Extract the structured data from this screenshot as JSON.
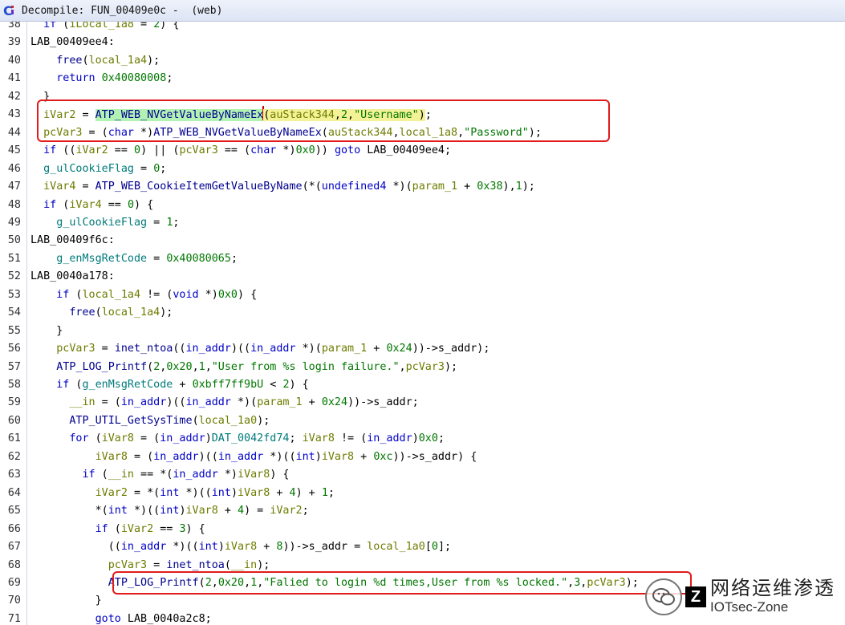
{
  "window": {
    "title": "Decompile: FUN_00409e0c -  (web)",
    "icon": "decompiler-icon"
  },
  "lines": [
    {
      "n": "38",
      "html": "  <span class='kw'>if</span> (<span class='var'>iLocal_1a8</span> = <span class='num'>2</span>) {"
    },
    {
      "n": "39",
      "html": "<span class='lab'>LAB_00409ee4:</span>"
    },
    {
      "n": "40",
      "html": "    <span class='fn'>free</span>(<span class='var'>local_1a4</span>);"
    },
    {
      "n": "41",
      "html": "    <span class='kw'>return</span> <span class='num'>0x40080008</span>;"
    },
    {
      "n": "42",
      "html": "  }"
    },
    {
      "n": "43",
      "html": "  <span class='var'>iVar2</span> = <span class='fn hl-fn'>ATP_WEB_NVGetValueByNameEx</span><span class='cursor'></span><span class='hl-args'>(<span class='var'>auStack344</span>,<span class='num'>2</span>,<span class='str'>\"Username\"</span>)</span>;"
    },
    {
      "n": "44",
      "html": "  <span class='var'>pcVar3</span> = (<span class='typ'>char</span> *)<span class='fn'>ATP_WEB_NVGetValueByNameEx</span>(<span class='var'>auStack344</span>,<span class='var'>local_1a8</span>,<span class='str'>\"Password\"</span>);"
    },
    {
      "n": "45",
      "html": "  <span class='kw'>if</span> ((<span class='var'>iVar2</span> == <span class='num'>0</span>) || (<span class='var'>pcVar3</span> == (<span class='typ'>char</span> *)<span class='num'>0x0</span>)) <span class='kw'>goto</span> LAB_00409ee4;"
    },
    {
      "n": "46",
      "html": "  <span class='glb'>g_ulCookieFlag</span> = <span class='num'>0</span>;"
    },
    {
      "n": "47",
      "html": "  <span class='var'>iVar4</span> = <span class='fn'>ATP_WEB_CookieItemGetValueByName</span>(*(<span class='typ'>undefined4</span> *)(<span class='var'>param_1</span> + <span class='num'>0x38</span>),<span class='num'>1</span>);"
    },
    {
      "n": "48",
      "html": "  <span class='kw'>if</span> (<span class='var'>iVar4</span> == <span class='num'>0</span>) {"
    },
    {
      "n": "49",
      "html": "    <span class='glb'>g_ulCookieFlag</span> = <span class='num'>1</span>;"
    },
    {
      "n": "50",
      "html": "<span class='lab'>LAB_00409f6c:</span>"
    },
    {
      "n": "51",
      "html": "    <span class='glb'>g_enMsgRetCode</span> = <span class='num'>0x40080065</span>;"
    },
    {
      "n": "52",
      "html": "<span class='lab'>LAB_0040a178:</span>"
    },
    {
      "n": "53",
      "html": "    <span class='kw'>if</span> (<span class='var'>local_1a4</span> != (<span class='typ'>void</span> *)<span class='num'>0x0</span>) {"
    },
    {
      "n": "54",
      "html": "      <span class='fn'>free</span>(<span class='var'>local_1a4</span>);"
    },
    {
      "n": "55",
      "html": "    }"
    },
    {
      "n": "56",
      "html": "    <span class='var'>pcVar3</span> = <span class='fn'>inet_ntoa</span>((<span class='typ'>in_addr</span>)((<span class='typ'>in_addr</span> *)(<span class='var'>param_1</span> + <span class='num'>0x24</span>))-&gt;s_addr);"
    },
    {
      "n": "57",
      "html": "    <span class='fn'>ATP_LOG_Printf</span>(<span class='num'>2</span>,<span class='num'>0x20</span>,<span class='num'>1</span>,<span class='str'>\"User from %s login failure.\"</span>,<span class='var'>pcVar3</span>);"
    },
    {
      "n": "58",
      "html": "    <span class='kw'>if</span> (<span class='glb'>g_enMsgRetCode</span> + <span class='num'>0xbff7ff9bU</span> &lt; <span class='num'>2</span>) {"
    },
    {
      "n": "59",
      "html": "      <span class='var'>__in</span> = (<span class='typ'>in_addr</span>)((<span class='typ'>in_addr</span> *)(<span class='var'>param_1</span> + <span class='num'>0x24</span>))-&gt;s_addr;"
    },
    {
      "n": "60",
      "html": "      <span class='fn'>ATP_UTIL_GetSysTime</span>(<span class='var'>local_1a0</span>);"
    },
    {
      "n": "61",
      "html": "      <span class='kw'>for</span> (<span class='var'>iVar8</span> = (<span class='typ'>in_addr</span>)<span class='glb'>DAT_0042fd74</span>; <span class='var'>iVar8</span> != (<span class='typ'>in_addr</span>)<span class='num'>0x0</span>;"
    },
    {
      "n": "62",
      "html": "          <span class='var'>iVar8</span> = (<span class='typ'>in_addr</span>)((<span class='typ'>in_addr</span> *)((<span class='typ'>int</span>)<span class='var'>iVar8</span> + <span class='num'>0xc</span>))-&gt;s_addr) {"
    },
    {
      "n": "63",
      "html": "        <span class='kw'>if</span> (<span class='var'>__in</span> == *(<span class='typ'>in_addr</span> *)<span class='var'>iVar8</span>) {"
    },
    {
      "n": "64",
      "html": "          <span class='var'>iVar2</span> = *(<span class='typ'>int</span> *)((<span class='typ'>int</span>)<span class='var'>iVar8</span> + <span class='num'>4</span>) + <span class='num'>1</span>;"
    },
    {
      "n": "65",
      "html": "          *(<span class='typ'>int</span> *)((<span class='typ'>int</span>)<span class='var'>iVar8</span> + <span class='num'>4</span>) = <span class='var'>iVar2</span>;"
    },
    {
      "n": "66",
      "html": "          <span class='kw'>if</span> (<span class='var'>iVar2</span> == <span class='num'>3</span>) {"
    },
    {
      "n": "67",
      "html": "            ((<span class='typ'>in_addr</span> *)((<span class='typ'>int</span>)<span class='var'>iVar8</span> + <span class='num'>8</span>))-&gt;s_addr = <span class='var'>local_1a0</span>[<span class='num'>0</span>];"
    },
    {
      "n": "68",
      "html": "            <span class='var'>pcVar3</span> = <span class='fn'>inet_ntoa</span>(<span class='var'>__in</span>);"
    },
    {
      "n": "69",
      "html": "            <span class='fn'>ATP_LOG_Printf</span>(<span class='num'>2</span>,<span class='num'>0x20</span>,<span class='num'>1</span>,<span class='str'>\"Falied to login %d times,User from %s locked.\"</span>,<span class='num'>3</span>,<span class='var'>pcVar3</span>);"
    },
    {
      "n": "70",
      "html": "          }"
    },
    {
      "n": "71",
      "html": "          <span class='kw'>goto</span> LAB_0040a2c8;"
    }
  ],
  "watermark": {
    "cn": "网络运维渗透",
    "en": "IOTsec-Zone",
    "z": "Z"
  }
}
